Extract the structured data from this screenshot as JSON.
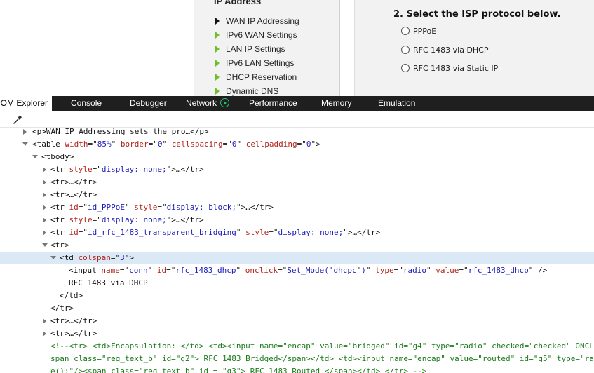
{
  "page": {
    "section_title": "IP Address",
    "nav_items": [
      {
        "label": "WAN IP Addressing",
        "active": true
      },
      {
        "label": "IPv6 WAN Settings",
        "active": false
      },
      {
        "label": "LAN IP Settings",
        "active": false
      },
      {
        "label": "IPv6 LAN Settings",
        "active": false
      },
      {
        "label": "DHCP Reservation",
        "active": false
      },
      {
        "label": "Dynamic DNS",
        "active": false
      }
    ],
    "step_title": "2. Select the ISP protocol below.",
    "radio_options": [
      "PPPoE",
      "RFC 1483 via DHCP",
      "RFC 1483 via Static IP"
    ]
  },
  "devtools": {
    "tabs": [
      "DOM Explorer",
      "Console",
      "Debugger",
      "Network",
      "Performance",
      "Memory",
      "Emulation"
    ],
    "active_tab": "DOM Explorer",
    "dom_lines": [
      {
        "tw": "none",
        "segs": [
          [
            "t",
            "<p>WAN IP Addressing sets the pro…</p>"
          ]
        ]
      },
      {
        "tw": "expanded",
        "segs": [
          [
            "t",
            "<table "
          ],
          [
            "an",
            "width"
          ],
          [
            "t",
            "=\""
          ],
          [
            "av",
            "85%"
          ],
          [
            "t",
            "\" "
          ],
          [
            "an",
            "border"
          ],
          [
            "t",
            "=\""
          ],
          [
            "av",
            "0"
          ],
          [
            "t",
            "\" "
          ],
          [
            "an",
            "cellspacing"
          ],
          [
            "t",
            "=\""
          ],
          [
            "av",
            "0"
          ],
          [
            "t",
            "\" "
          ],
          [
            "an",
            "cellpadding"
          ],
          [
            "t",
            "=\""
          ],
          [
            "av",
            "0"
          ],
          [
            "t",
            "\">"
          ]
        ]
      },
      {
        "tw": "expanded",
        "segs": [
          [
            "t",
            "<tbody>"
          ]
        ]
      },
      {
        "tw": "collapsed",
        "segs": [
          [
            "t",
            "<tr "
          ],
          [
            "an",
            "style"
          ],
          [
            "t",
            "=\""
          ],
          [
            "av",
            "display: none;"
          ],
          [
            "t",
            "\">…</tr>"
          ]
        ]
      },
      {
        "tw": "collapsed",
        "segs": [
          [
            "t",
            "<tr>…</tr>"
          ]
        ]
      },
      {
        "tw": "collapsed",
        "segs": [
          [
            "t",
            "<tr>…</tr>"
          ]
        ]
      },
      {
        "tw": "collapsed",
        "segs": [
          [
            "t",
            "<tr "
          ],
          [
            "an",
            "id"
          ],
          [
            "t",
            "=\""
          ],
          [
            "av",
            "id_PPPoE"
          ],
          [
            "t",
            "\" "
          ],
          [
            "an",
            "style"
          ],
          [
            "t",
            "=\""
          ],
          [
            "av",
            "display: block;"
          ],
          [
            "t",
            "\">…</tr>"
          ]
        ]
      },
      {
        "tw": "collapsed",
        "segs": [
          [
            "t",
            "<tr "
          ],
          [
            "an",
            "style"
          ],
          [
            "t",
            "=\""
          ],
          [
            "av",
            "display: none;"
          ],
          [
            "t",
            "\">…</tr>"
          ]
        ]
      },
      {
        "tw": "collapsed",
        "segs": [
          [
            "t",
            "<tr "
          ],
          [
            "an",
            "id"
          ],
          [
            "t",
            "=\""
          ],
          [
            "av",
            "id_rfc_1483_transparent_bridging"
          ],
          [
            "t",
            "\" "
          ],
          [
            "an",
            "style"
          ],
          [
            "t",
            "=\""
          ],
          [
            "av",
            "display: none;"
          ],
          [
            "t",
            "\">…</tr>"
          ]
        ]
      },
      {
        "tw": "expanded",
        "segs": [
          [
            "t",
            "<tr>"
          ]
        ]
      },
      {
        "tw": "expanded",
        "selected": true,
        "segs": [
          [
            "t",
            "<td "
          ],
          [
            "an",
            "colspan"
          ],
          [
            "t",
            "=\""
          ],
          [
            "av",
            "3"
          ],
          [
            "t",
            "\">"
          ]
        ]
      },
      {
        "tw": "none",
        "segs": [
          [
            "t",
            "<input "
          ],
          [
            "an",
            "name"
          ],
          [
            "t",
            "=\""
          ],
          [
            "av",
            "conn"
          ],
          [
            "t",
            "\" "
          ],
          [
            "an",
            "id"
          ],
          [
            "t",
            "=\""
          ],
          [
            "av",
            "rfc_1483_dhcp"
          ],
          [
            "t",
            "\" "
          ],
          [
            "an",
            "onclick"
          ],
          [
            "t",
            "=\""
          ],
          [
            "av",
            "Set_Mode('dhcpc')"
          ],
          [
            "t",
            "\" "
          ],
          [
            "an",
            "type"
          ],
          [
            "t",
            "=\""
          ],
          [
            "av",
            "radio"
          ],
          [
            "t",
            "\" "
          ],
          [
            "an",
            "value"
          ],
          [
            "t",
            "=\""
          ],
          [
            "av",
            "rfc_1483_dhcp"
          ],
          [
            "t",
            "\" />"
          ]
        ]
      },
      {
        "tw": "none",
        "segs": [
          [
            "tx",
            "RFC 1483 via DHCP"
          ]
        ]
      },
      {
        "tw": "none",
        "segs": [
          [
            "t",
            "</td>"
          ]
        ]
      },
      {
        "tw": "none",
        "segs": [
          [
            "t",
            "</tr>"
          ]
        ]
      },
      {
        "tw": "collapsed",
        "segs": [
          [
            "t",
            "<tr>…</tr>"
          ]
        ]
      },
      {
        "tw": "collapsed",
        "segs": [
          [
            "t",
            "<tr>…</tr>"
          ]
        ]
      },
      {
        "tw": "none",
        "segs": [
          [
            "cm",
            "<!--<tr> <td>Encapsulation: </td> <td><input name=\"encap\" value=\"bridged\" id=\"g4\" type=\"radio\" checked=\"checked\" ONCLICK=\"cl"
          ]
        ]
      },
      {
        "tw": "none",
        "segs": [
          [
            "cm",
            "span class=\"reg_text_b\" id=\"g2\"> RFC 1483 Bridged</span></td> <td><input name=\"encap\" value=\"routed\" id=\"g5\" type=\"radio\""
          ]
        ]
      },
      {
        "tw": "none",
        "segs": [
          [
            "cm",
            "e();\"/><span class=\"reg_text_b\" id = \"g3\"> RFC 1483 Routed </span></td> </tr> -->"
          ]
        ]
      }
    ]
  }
}
